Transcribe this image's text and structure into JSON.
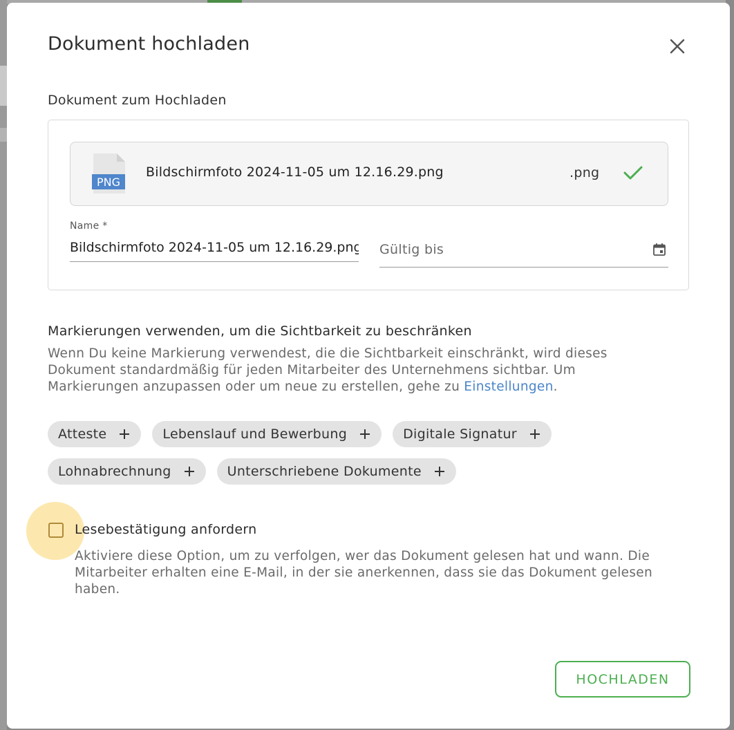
{
  "dialog": {
    "title": "Dokument hochladen",
    "close_icon": "close-icon"
  },
  "upload": {
    "section_label": "Dokument zum Hochladen",
    "file": {
      "icon_label": "PNG",
      "icon": "png-file-icon",
      "name": "Bildschirmfoto 2024-11-05 um 12.16.29.png",
      "extension": ".png",
      "status_icon": "checkmark-icon",
      "status_color": "#4caf50"
    },
    "name_field": {
      "label": "Name *",
      "value": "Bildschirmfoto 2024-11-05 um 12.16.29.png"
    },
    "valid_until": {
      "placeholder": "Gültig bis",
      "icon": "calendar-icon"
    }
  },
  "tags": {
    "heading": "Markierungen verwenden, um die Sichtbarkeit zu beschränken",
    "description": "Wenn Du keine Markierung verwendest, die die Sichtbarkeit einschränkt, wird dieses Dokument standardmäßig für jeden Mitarbeiter des Unternehmens sichtbar. Um Markierungen anzupassen oder um neue zu erstellen, gehe zu ",
    "link": "Einstellungen",
    "description_end": ".",
    "items_row1": [
      "Atteste",
      "Lebenslauf und Bewerbung",
      "Digitale Signatur"
    ],
    "items_row2": [
      "Lohnabrechnung",
      "Unterschriebene Dokumente"
    ]
  },
  "read_confirmation": {
    "label": "Lesebestätigung anfordern",
    "checked": false,
    "description": "Aktiviere diese Option, um zu verfolgen, wer das Dokument gelesen hat und wann. Die Mitarbeiter erhalten eine E-Mail, in der sie anerkennen, dass sie das Dokument gelesen haben."
  },
  "actions": {
    "upload_label": "HOCHLADEN",
    "accent_color": "#4caf50",
    "link_color": "#4a86c8"
  }
}
